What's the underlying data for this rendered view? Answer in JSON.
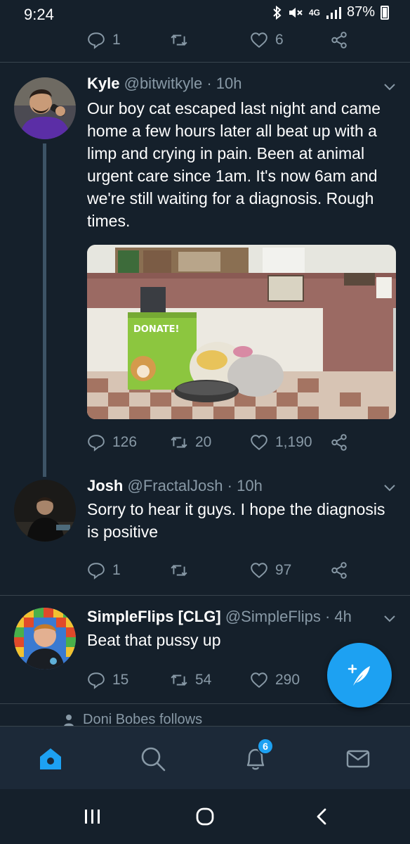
{
  "status_bar": {
    "time": "9:24",
    "network": "4G",
    "battery": "87%"
  },
  "prev_tweet_actions": {
    "replies": "1",
    "retweets": "",
    "likes": "6"
  },
  "tweets": [
    {
      "name": "Kyle",
      "handle": "@bitwitkyle",
      "time": "· 10h",
      "text": "Our boy cat escaped last night and came home a few hours later all beat up with a limp and crying in pain. Been at animal urgent care since 1am. It's now 6am and we're still waiting for a diagnosis. Rough times.",
      "replies": "126",
      "retweets": "20",
      "likes": "1,190"
    },
    {
      "name": "Josh",
      "handle": "@FractalJosh",
      "time": "· 10h",
      "text": "Sorry to hear it guys. I hope the diagnosis is positive",
      "replies": "1",
      "retweets": "",
      "likes": "97"
    },
    {
      "name": "SimpleFlips [CLG]",
      "handle": "@SimpleFlips",
      "time": "· 4h",
      "text": "Beat that pussy up",
      "replies": "15",
      "retweets": "54",
      "likes": "290"
    }
  ],
  "media": {
    "box_text": "DONATE!"
  },
  "follows_line": "Doni Bobes follows",
  "bottom_nav": {
    "notification_count": "6"
  },
  "colors": {
    "background": "#15202b",
    "accent": "#1da1f2",
    "muted": "#8899a6"
  }
}
